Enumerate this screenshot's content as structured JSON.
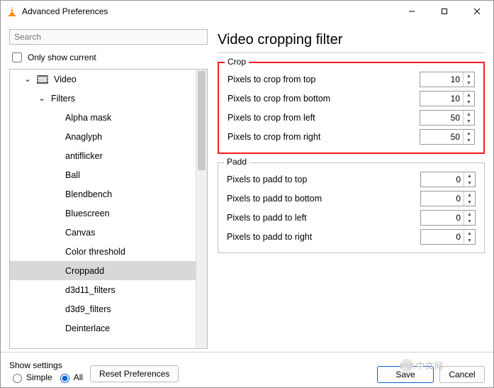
{
  "window": {
    "title": "Advanced Preferences"
  },
  "search": {
    "placeholder": "Search"
  },
  "only_show_current": "Only show current",
  "tree": {
    "video": "Video",
    "filters": "Filters",
    "items": [
      "Alpha mask",
      "Anaglyph",
      "antiflicker",
      "Ball",
      "Blendbench",
      "Bluescreen",
      "Canvas",
      "Color threshold",
      "Croppadd",
      "d3d11_filters",
      "d3d9_filters",
      "Deinterlace"
    ],
    "selected_index": 8
  },
  "right": {
    "title": "Video cropping filter",
    "crop": {
      "legend": "Crop",
      "fields": [
        {
          "label": "Pixels to crop from top",
          "value": 10
        },
        {
          "label": "Pixels to crop from bottom",
          "value": 10
        },
        {
          "label": "Pixels to crop from left",
          "value": 50
        },
        {
          "label": "Pixels to crop from right",
          "value": 50
        }
      ]
    },
    "padd": {
      "legend": "Padd",
      "fields": [
        {
          "label": "Pixels to padd to top",
          "value": 0
        },
        {
          "label": "Pixels to padd to bottom",
          "value": 0
        },
        {
          "label": "Pixels to padd to left",
          "value": 0
        },
        {
          "label": "Pixels to padd to right",
          "value": 0
        }
      ]
    }
  },
  "bottom": {
    "show_settings": "Show settings",
    "simple": "Simple",
    "all": "All",
    "selected": "all",
    "reset": "Reset Preferences",
    "save": "Save",
    "cancel": "Cancel"
  },
  "watermark": "中文网"
}
